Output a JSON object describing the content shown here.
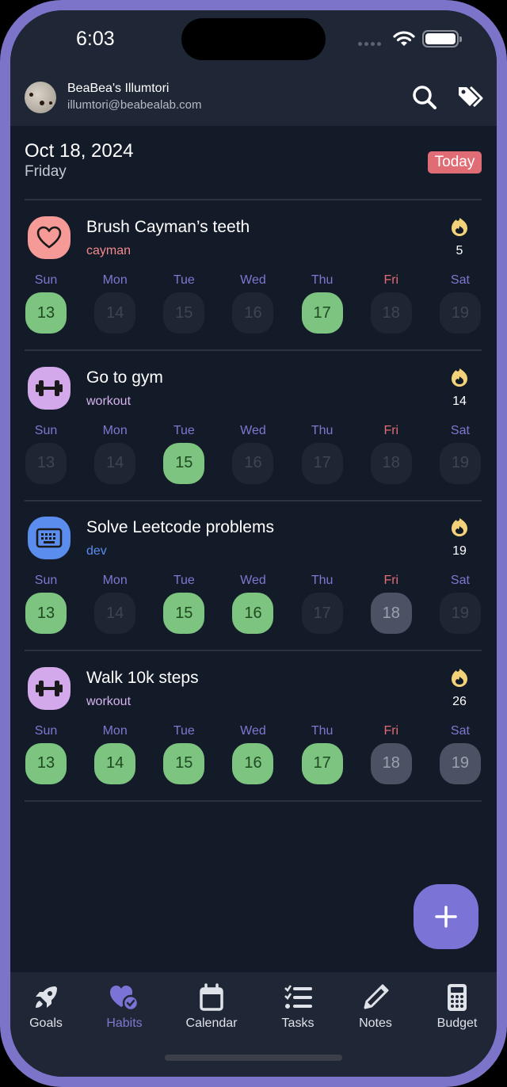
{
  "status_bar": {
    "time": "6:03"
  },
  "header": {
    "user_name": "BeaBea's Illumtori",
    "user_email": "illumtori@beabealab.com",
    "search_icon": "search-icon",
    "tags_icon": "tags-icon"
  },
  "date_header": {
    "date": "Oct 18, 2024",
    "weekday": "Friday",
    "today_label": "Today"
  },
  "colors": {
    "accent": "#7b74d6",
    "done": "#7cc47f",
    "today_badge": "#e06c75",
    "streak": "#f3d27a"
  },
  "day_labels": [
    "Sun",
    "Mon",
    "Tue",
    "Wed",
    "Thu",
    "Fri",
    "Sat"
  ],
  "habits": [
    {
      "title": "Brush Cayman’s teeth",
      "tag": "cayman",
      "tag_color": "#f28b8b",
      "icon": "heart-icon",
      "icon_bg": "#f59a96",
      "streak": "5",
      "days": [
        {
          "date": "13",
          "state": "done"
        },
        {
          "date": "14",
          "state": "empty"
        },
        {
          "date": "15",
          "state": "empty"
        },
        {
          "date": "16",
          "state": "empty"
        },
        {
          "date": "17",
          "state": "done"
        },
        {
          "date": "18",
          "state": "empty"
        },
        {
          "date": "19",
          "state": "empty"
        }
      ]
    },
    {
      "title": "Go to gym",
      "tag": "workout",
      "tag_color": "#d5b3ee",
      "icon": "dumbbell-icon",
      "icon_bg": "#d3a9ec",
      "streak": "14",
      "days": [
        {
          "date": "13",
          "state": "empty"
        },
        {
          "date": "14",
          "state": "empty"
        },
        {
          "date": "15",
          "state": "done"
        },
        {
          "date": "16",
          "state": "empty"
        },
        {
          "date": "17",
          "state": "empty"
        },
        {
          "date": "18",
          "state": "empty"
        },
        {
          "date": "19",
          "state": "empty"
        }
      ]
    },
    {
      "title": "Solve Leetcode problems",
      "tag": "dev",
      "tag_color": "#5b8def",
      "icon": "keyboard-icon",
      "icon_bg": "#5b8def",
      "streak": "19",
      "days": [
        {
          "date": "13",
          "state": "done"
        },
        {
          "date": "14",
          "state": "empty"
        },
        {
          "date": "15",
          "state": "done"
        },
        {
          "date": "16",
          "state": "done"
        },
        {
          "date": "17",
          "state": "empty"
        },
        {
          "date": "18",
          "state": "pending"
        },
        {
          "date": "19",
          "state": "empty"
        }
      ]
    },
    {
      "title": "Walk 10k steps",
      "tag": "workout",
      "tag_color": "#d5b3ee",
      "icon": "dumbbell-icon",
      "icon_bg": "#d3a9ec",
      "streak": "26",
      "days": [
        {
          "date": "13",
          "state": "done"
        },
        {
          "date": "14",
          "state": "done"
        },
        {
          "date": "15",
          "state": "done"
        },
        {
          "date": "16",
          "state": "done"
        },
        {
          "date": "17",
          "state": "done"
        },
        {
          "date": "18",
          "state": "pending"
        },
        {
          "date": "19",
          "state": "pending"
        }
      ]
    }
  ],
  "fab": {
    "icon": "plus-icon"
  },
  "bottom_nav": [
    {
      "label": "Goals",
      "icon": "rocket-icon",
      "active": false
    },
    {
      "label": "Habits",
      "icon": "habits-heart-icon",
      "active": true
    },
    {
      "label": "Calendar",
      "icon": "calendar-icon",
      "active": false
    },
    {
      "label": "Tasks",
      "icon": "checklist-icon",
      "active": false
    },
    {
      "label": "Notes",
      "icon": "pencil-icon",
      "active": false
    },
    {
      "label": "Budget",
      "icon": "calculator-icon",
      "active": false
    }
  ]
}
